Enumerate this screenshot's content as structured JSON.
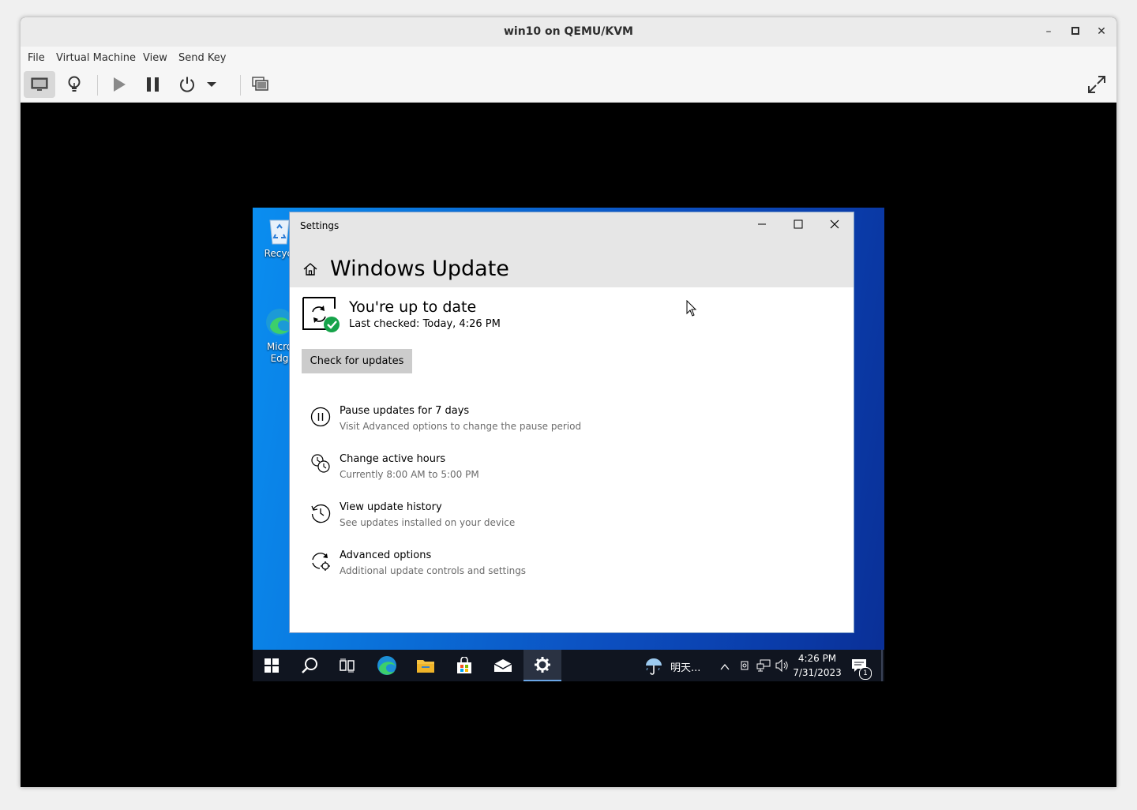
{
  "host": {
    "title": "win10 on QEMU/KVM",
    "controls": {
      "minimize": "–",
      "maximize": "□",
      "close": "✕"
    },
    "menu": [
      "File",
      "Virtual Machine",
      "View",
      "Send Key"
    ]
  },
  "desktop": {
    "icons": [
      {
        "label": "Recycl",
        "icon": "recycle-bin-icon"
      },
      {
        "label": "Micro\nEdg",
        "icon": "edge-icon"
      }
    ]
  },
  "settings": {
    "window_title": "Settings",
    "page_title": "Windows Update",
    "status": {
      "title": "You're up to date",
      "last_checked": "Last checked: Today, 4:26 PM"
    },
    "check_button": "Check for updates",
    "options": [
      {
        "title": "Pause updates for 7 days",
        "subtitle": "Visit Advanced options to change the pause period",
        "icon": "pause-icon"
      },
      {
        "title": "Change active hours",
        "subtitle": "Currently 8:00 AM to 5:00 PM",
        "icon": "clock-icon"
      },
      {
        "title": "View update history",
        "subtitle": "See updates installed on your device",
        "icon": "history-icon"
      },
      {
        "title": "Advanced options",
        "subtitle": "Additional update controls and settings",
        "icon": "gear-sync-icon"
      }
    ]
  },
  "taskbar": {
    "weather": "明天...",
    "time": "4:26 PM",
    "date": "7/31/2023",
    "notification_count": "1"
  },
  "colors": {
    "accent": "#0078d7",
    "success": "#16a34a"
  }
}
